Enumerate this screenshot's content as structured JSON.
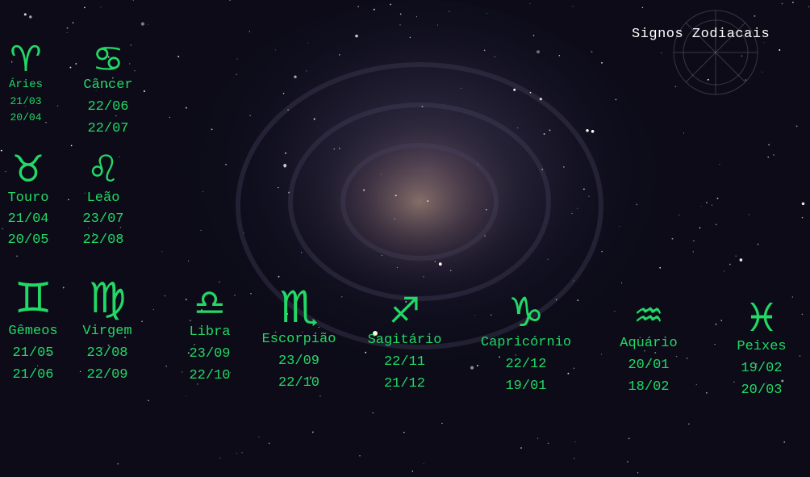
{
  "title": "Signos Zodiacais",
  "colors": {
    "accent": "#22d866",
    "title": "#ffffff",
    "background": "#0b0a16"
  },
  "signs": [
    {
      "id": "aries",
      "glyph": "♈",
      "name": "Áries",
      "start": "21/03",
      "end": "20/04"
    },
    {
      "id": "cancer",
      "glyph": "♋",
      "name": "Câncer",
      "start": "22/06",
      "end": "22/07"
    },
    {
      "id": "touro",
      "glyph": "♉",
      "name": "Touro",
      "start": "21/04",
      "end": "20/05"
    },
    {
      "id": "leao",
      "glyph": "♌",
      "name": "Leão",
      "start": "23/07",
      "end": "22/08"
    },
    {
      "id": "gemeos",
      "glyph": "♊",
      "name": "Gêmeos",
      "start": "21/05",
      "end": "21/06"
    },
    {
      "id": "virgem",
      "glyph": "♍",
      "name": "Virgem",
      "start": "23/08",
      "end": "22/09"
    },
    {
      "id": "libra",
      "glyph": "♎",
      "name": "Libra",
      "start": "23/09",
      "end": "22/10"
    },
    {
      "id": "escorpiao",
      "glyph": "♏",
      "name": "Escorpião",
      "start": "23/09",
      "end": "22/10"
    },
    {
      "id": "sagitario",
      "glyph": "♐",
      "name": "Sagitário",
      "start": "22/11",
      "end": "21/12"
    },
    {
      "id": "capricornio",
      "glyph": "♑",
      "name": "Capricórnio",
      "start": "22/12",
      "end": "19/01"
    },
    {
      "id": "aquario",
      "glyph": "♒",
      "name": "Aquário",
      "start": "20/01",
      "end": "18/02"
    },
    {
      "id": "peixes",
      "glyph": "♓",
      "name": "Peixes",
      "start": "19/02",
      "end": "20/03"
    }
  ]
}
